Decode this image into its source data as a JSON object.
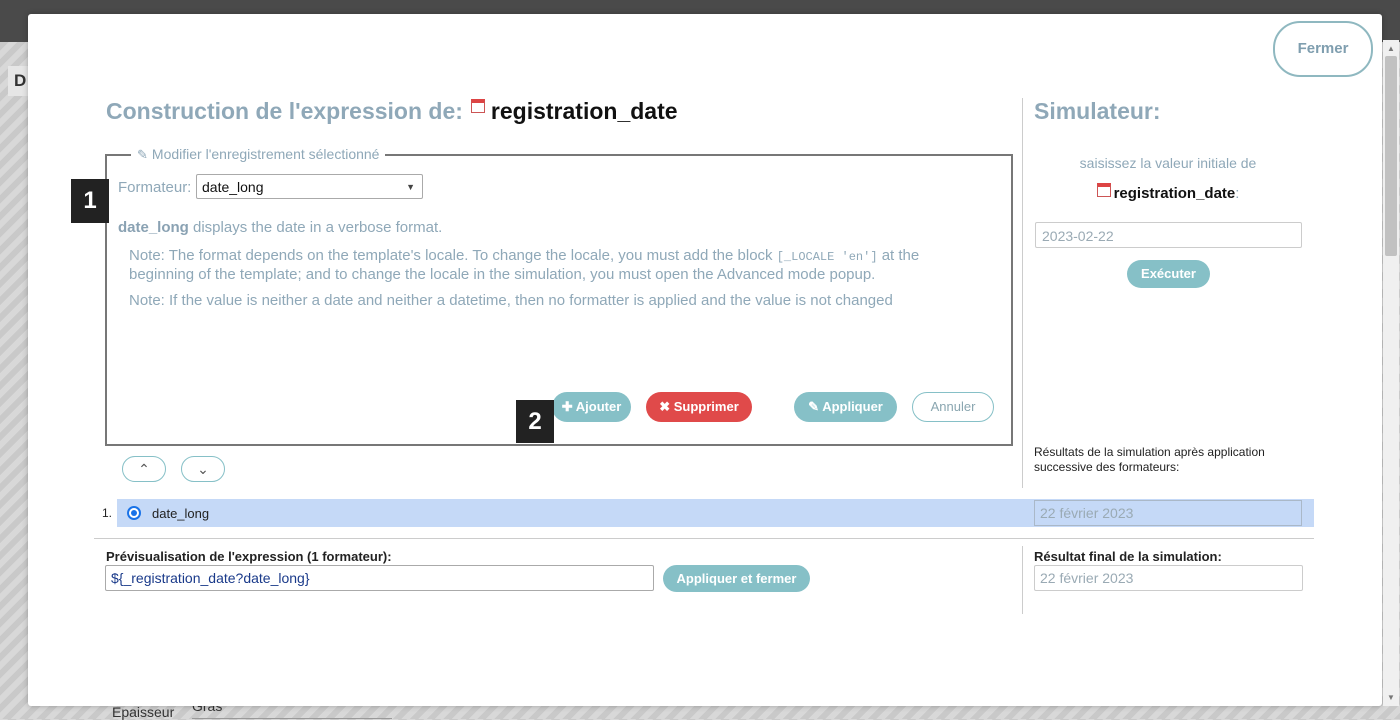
{
  "background": {
    "left_letter": "D",
    "bottom_label": "Epaisseur",
    "bottom_select": "Gras"
  },
  "modal": {
    "close_label": "Fermer",
    "title_prefix": "Construction de l'expression de:",
    "field_name": "registration_date",
    "fieldset_legend": "Modifier l'enregistrement sélectionné",
    "formatter_label": "Formateur:",
    "formatter_value": "date_long",
    "desc_name": "date_long",
    "desc_text": " displays the date in a verbose format.",
    "note1_a": "Note: The format depends on the template's locale. To change the locale, you must add the block ",
    "note1_code": "[_LOCALE 'en']",
    "note1_b": " at the beginning of the template; and to change the locale in the simulation, you must open the Advanced mode popup.",
    "note2": "Note: If the value is neither a date and neither a datetime, then no formatter is applied and the value is not changed",
    "buttons": {
      "add": "Ajouter",
      "delete": "Supprimer",
      "apply": "Appliquer",
      "cancel": "Annuler",
      "apply_close": "Appliquer et fermer"
    },
    "badges": {
      "b1": "1",
      "b2": "2"
    },
    "formatter_list": [
      {
        "num": "1.",
        "label": "date_long",
        "result": "22 février 2023"
      }
    ],
    "preview_label": "Prévisualisation de l'expression (1 formateur):",
    "preview_value": "${_registration_date?date_long}"
  },
  "simulator": {
    "title": "Simulateur:",
    "subtitle": "saisissez la valeur initiale de",
    "field_name": "registration_date",
    "colon": ":",
    "input_value": "2023-02-22",
    "execute_label": "Exécuter",
    "results_label": "Résultats de la simulation après application successive des formateurs:",
    "final_label": "Résultat final de la simulation:",
    "final_value": "22 février 2023"
  },
  "colors": {
    "accent": "#86c0c7",
    "danger": "#e04a4a",
    "muted_text": "#8fa8b8",
    "selected_row": "#c5d9f7"
  }
}
